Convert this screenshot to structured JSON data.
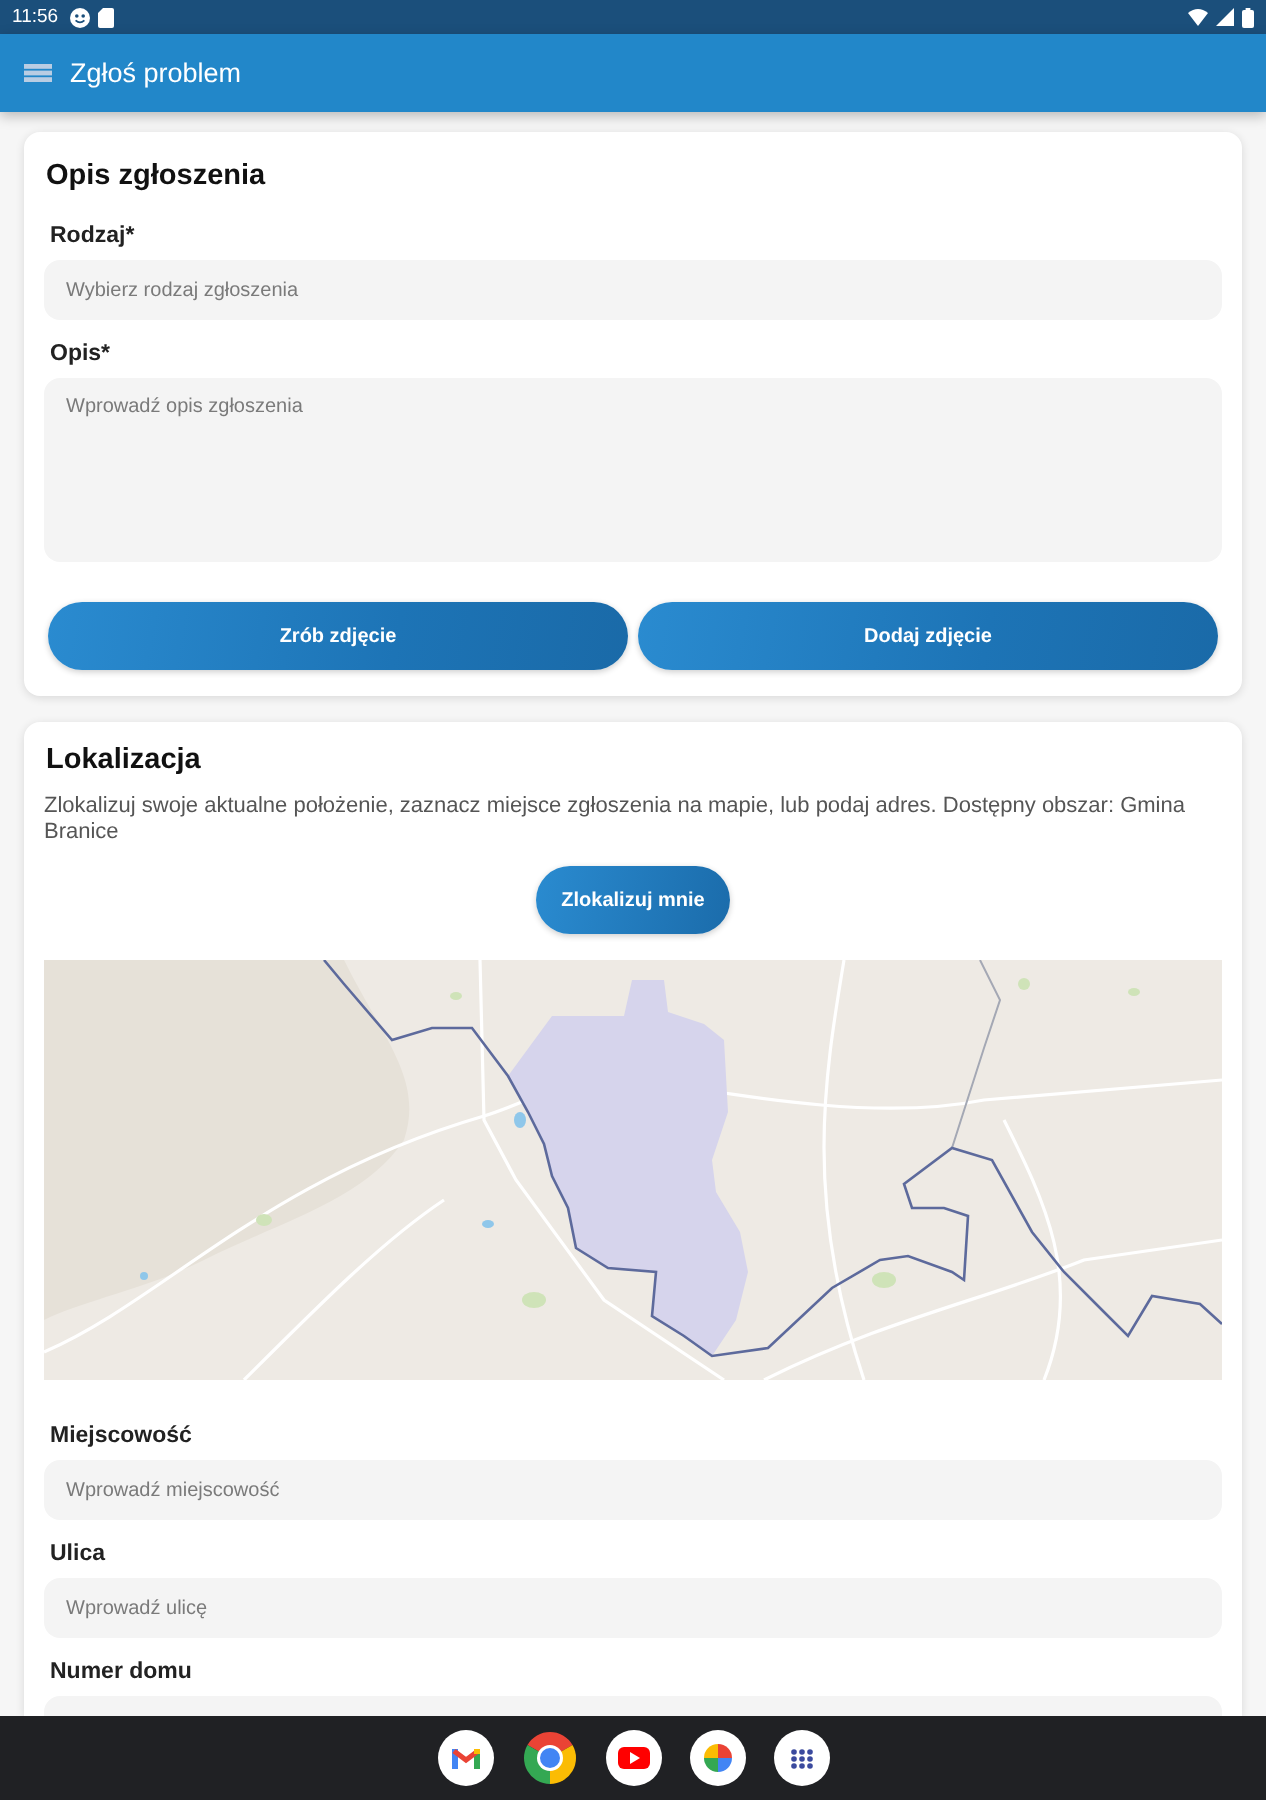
{
  "status_bar": {
    "time": "11:56"
  },
  "app_bar": {
    "title": "Zgłoś problem"
  },
  "report_card": {
    "title": "Opis zgłoszenia",
    "fields": [
      {
        "kind": "text",
        "label": "Rodzaj*",
        "placeholder": "Wybierz rodzaj zgłoszenia"
      },
      {
        "kind": "multiline",
        "label": "Opis*",
        "placeholder": "Wprowadź opis zgłoszenia"
      }
    ],
    "buttons": [
      "Zrób zdjęcie",
      "Dodaj zdjęcie"
    ]
  },
  "location_card": {
    "title": "Lokalizacja",
    "description": "Zlokalizuj swoje aktualne położenie, zaznacz miejsce zgłoszenia na mapie, lub podaj adres. Dostępny obszar: Gmina Branice",
    "locate_button": "Zlokalizuj mnie",
    "fields": [
      {
        "kind": "text",
        "label": "Miejscowość",
        "placeholder": "Wprowadź miejscowość"
      },
      {
        "kind": "text",
        "label": "Ulica",
        "placeholder": "Wprowadź ulicę"
      },
      {
        "kind": "text",
        "label": "Numer domu"
      }
    ]
  }
}
